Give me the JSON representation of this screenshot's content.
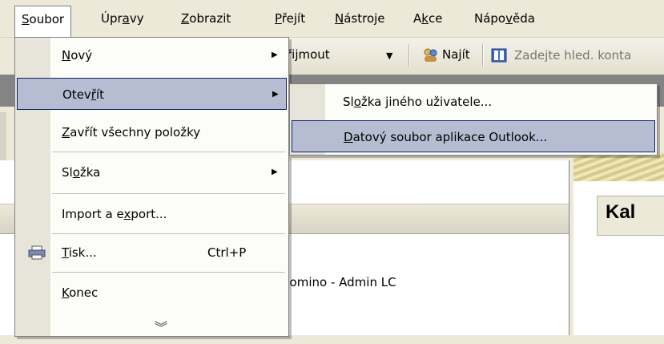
{
  "menubar": {
    "items": [
      "Soubor",
      "Úpravy",
      "Zobrazit",
      "Přejít",
      "Nástroje",
      "Akce",
      "Nápověda"
    ]
  },
  "toolbar": {
    "receive_label": "řijmout",
    "find_label": "Najít",
    "search_placeholder": "Zadejte hled. konta"
  },
  "file_menu": {
    "items": [
      {
        "label": "Nový",
        "has_submenu": true
      },
      {
        "label": "Otevřít",
        "has_submenu": true,
        "highlighted": true
      },
      {
        "label": "Zavřít všechny položky"
      },
      {
        "label": "Složka",
        "has_submenu": true
      },
      {
        "label": "Import a export..."
      },
      {
        "label": "Tisk...",
        "shortcut": "Ctrl+P",
        "icon": "printer-icon"
      },
      {
        "label": "Konec"
      }
    ],
    "expand_icon": "»"
  },
  "open_submenu": {
    "items": [
      {
        "label": "Složka jiného uživatele..."
      },
      {
        "label": "Datový soubor aplikace Outlook...",
        "highlighted": true
      }
    ]
  },
  "background": {
    "folder_text": "Domino - Admin LC",
    "calendar_title": "Kal"
  }
}
